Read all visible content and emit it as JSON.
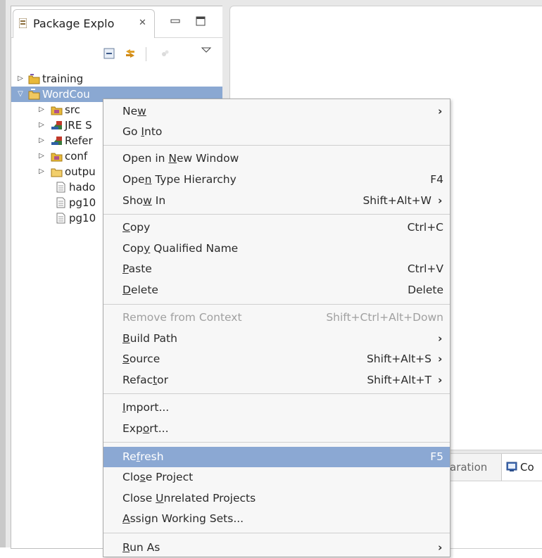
{
  "package_explorer": {
    "title": "Package Explo",
    "tree": [
      {
        "label": "training",
        "expanded": false
      },
      {
        "label": "WordCou",
        "expanded": true,
        "selected": true
      },
      {
        "label": "src",
        "expanded": false
      },
      {
        "label": "JRE S",
        "expanded": false
      },
      {
        "label": "Refer",
        "expanded": false
      },
      {
        "label": "conf",
        "expanded": false
      },
      {
        "label": "outpu",
        "expanded": false
      },
      {
        "label": "hado"
      },
      {
        "label": "pg10"
      },
      {
        "label": "pg10"
      }
    ]
  },
  "bottom_view": {
    "tab_partial": "aration",
    "active_tab_partial": "Co"
  },
  "context_menu": {
    "items": {
      "new": {
        "pre": "Ne",
        "u": "w",
        "post": ""
      },
      "go_into": {
        "pre": "Go ",
        "u": "I",
        "post": "nto"
      },
      "open_new_window": {
        "pre": "Open in ",
        "u": "N",
        "post": "ew Window"
      },
      "open_type_hierarchy": {
        "pre": "Ope",
        "u": "n",
        "post": " Type Hierarchy",
        "accel": "F4"
      },
      "show_in": {
        "pre": "Sho",
        "u": "w",
        "post": " In",
        "accel": "Shift+Alt+W"
      },
      "copy": {
        "pre": "",
        "u": "C",
        "post": "opy",
        "accel": "Ctrl+C"
      },
      "copy_qualified": {
        "pre": "Cop",
        "u": "y",
        "post": " Qualified Name"
      },
      "paste": {
        "pre": "",
        "u": "P",
        "post": "aste",
        "accel": "Ctrl+V"
      },
      "delete": {
        "pre": "",
        "u": "D",
        "post": "elete",
        "accel": "Delete"
      },
      "remove_context": {
        "label": "Remove from Context",
        "accel": "Shift+Ctrl+Alt+Down"
      },
      "build_path": {
        "pre": "",
        "u": "B",
        "post": "uild Path"
      },
      "source": {
        "pre": "",
        "u": "S",
        "post": "ource",
        "accel": "Shift+Alt+S"
      },
      "refactor": {
        "pre": "Refac",
        "u": "t",
        "post": "or",
        "accel": "Shift+Alt+T"
      },
      "import": {
        "pre": "",
        "u": "I",
        "post": "mport..."
      },
      "export": {
        "pre": "Exp",
        "u": "o",
        "post": "rt..."
      },
      "refresh": {
        "pre": "Re",
        "u": "f",
        "post": "resh",
        "accel": "F5"
      },
      "close_project": {
        "pre": "Clo",
        "u": "s",
        "post": "e Project"
      },
      "close_unrelated": {
        "pre": "Close ",
        "u": "U",
        "post": "nrelated Projects"
      },
      "assign_working": {
        "pre": "",
        "u": "A",
        "post": "ssign Working Sets..."
      },
      "run_as": {
        "pre": "",
        "u": "R",
        "post": "un As"
      }
    }
  }
}
